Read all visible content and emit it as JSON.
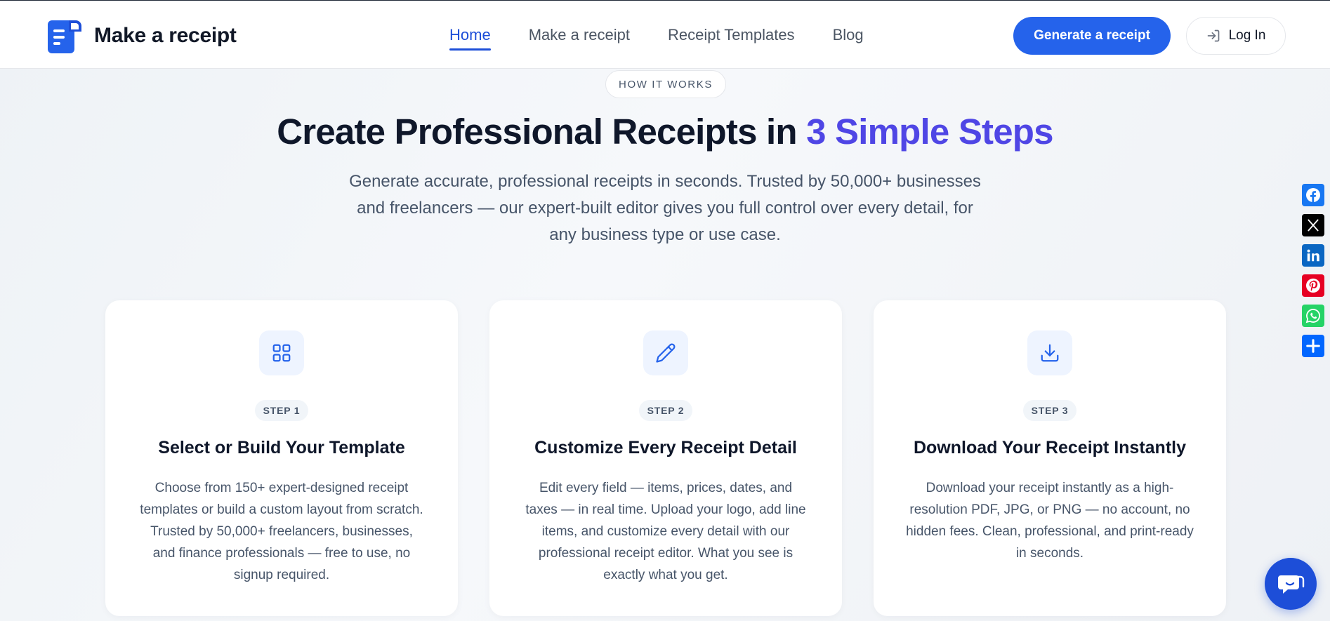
{
  "header": {
    "brand": "Make a receipt",
    "nav": [
      {
        "label": "Home",
        "active": true
      },
      {
        "label": "Make a receipt",
        "active": false
      },
      {
        "label": "Receipt Templates",
        "active": false
      },
      {
        "label": "Blog",
        "active": false
      }
    ],
    "cta_label": "Generate a receipt",
    "login_label": "Log In"
  },
  "hero": {
    "pill": "HOW IT WORKS",
    "headline_main": "Create Professional Receipts in ",
    "headline_accent": "3 Simple Steps",
    "subtext": "Generate accurate, professional receipts in seconds. Trusted by 50,000+ businesses and freelancers — our expert-built editor gives you full control over every detail, for any business type or use case."
  },
  "steps": [
    {
      "icon": "grid-icon",
      "badge": "STEP 1",
      "title": "Select or Build Your Template",
      "description": "Choose from 150+ expert-designed receipt templates or build a custom layout from scratch. Trusted by 50,000+ freelancers, businesses, and finance professionals — free to use, no signup required."
    },
    {
      "icon": "pencil-icon",
      "badge": "STEP 2",
      "title": "Customize Every Receipt Detail",
      "description": "Edit every field — items, prices, dates, and taxes — in real time. Upload your logo, add line items, and customize every detail with our professional receipt editor. What you see is exactly what you get."
    },
    {
      "icon": "download-icon",
      "badge": "STEP 3",
      "title": "Download Your Receipt Instantly",
      "description": "Download your receipt instantly as a high-resolution PDF, JPG, or PNG — no account, no hidden fees. Clean, professional, and print-ready in seconds."
    }
  ],
  "share": [
    {
      "icon": "facebook-icon",
      "color": "#1877f2"
    },
    {
      "icon": "x-icon",
      "color": "#000000"
    },
    {
      "icon": "linkedin-icon",
      "color": "#0a66c2"
    },
    {
      "icon": "pinterest-icon",
      "color": "#e60023"
    },
    {
      "icon": "whatsapp-icon",
      "color": "#25d366"
    },
    {
      "icon": "share-plus-icon",
      "color": "#0166ff"
    }
  ],
  "colors": {
    "primary": "#2563eb",
    "accent": "#4f46e5",
    "nav_active": "#1d4ed8"
  }
}
